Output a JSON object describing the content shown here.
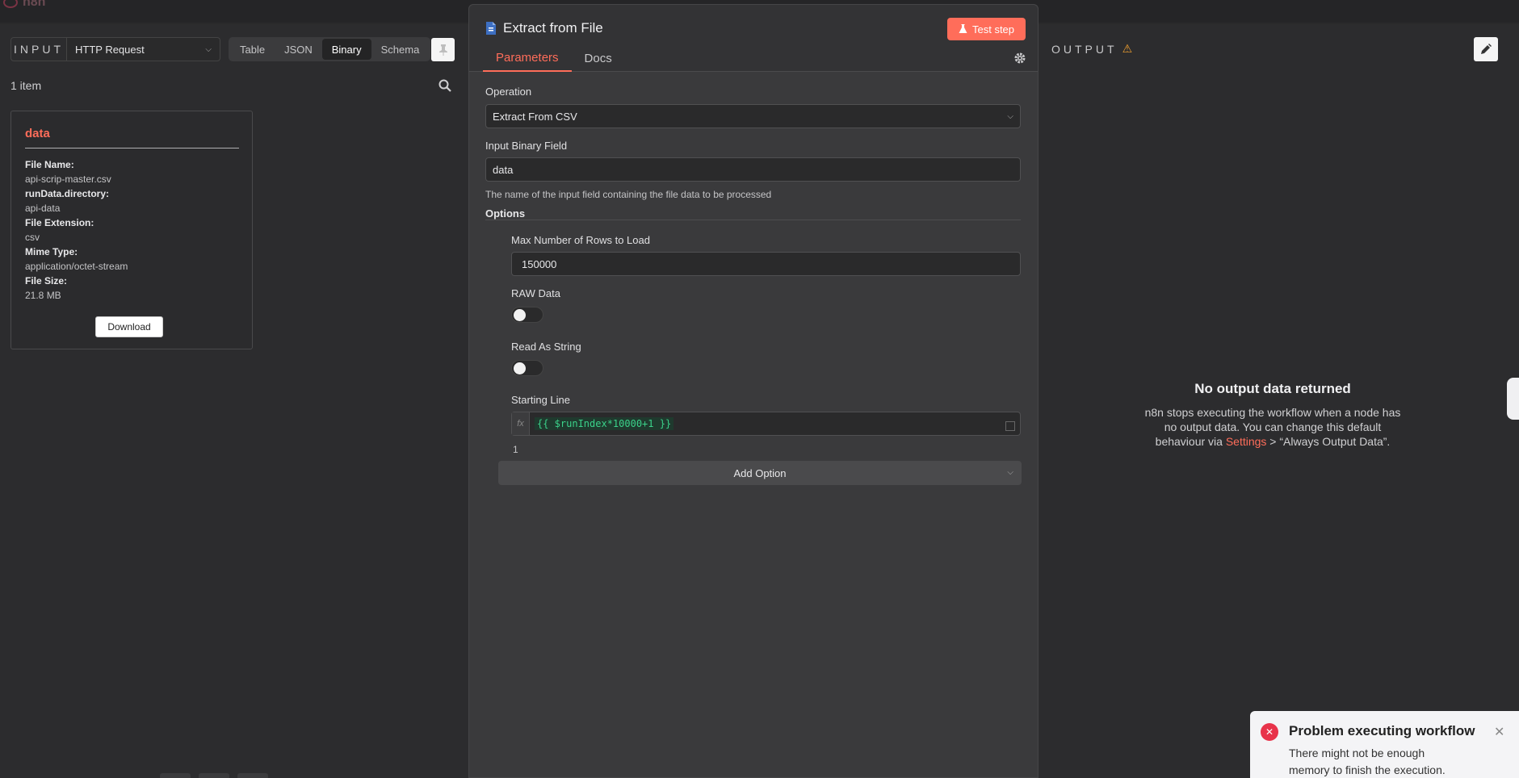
{
  "app": {
    "name": "n8n"
  },
  "input": {
    "label": "INPUT",
    "node": "HTTP Request",
    "view_tabs": [
      "Table",
      "JSON",
      "Binary",
      "Schema"
    ],
    "active_view": "Binary",
    "item_count": "1 item",
    "card": {
      "title": "data",
      "fields": [
        {
          "key": "File Name:",
          "value": "api-scrip-master.csv"
        },
        {
          "key": "runData.directory:",
          "value": "api-data"
        },
        {
          "key": "File Extension:",
          "value": "csv"
        },
        {
          "key": "Mime Type:",
          "value": "application/octet-stream"
        },
        {
          "key": "File Size:",
          "value": "21.8 MB"
        }
      ],
      "download_label": "Download"
    }
  },
  "node": {
    "title": "Extract from File",
    "test_button": "Test step",
    "tabs": [
      "Parameters",
      "Docs"
    ],
    "active_tab": "Parameters",
    "operation": {
      "label": "Operation",
      "value": "Extract From CSV"
    },
    "binary_field": {
      "label": "Input Binary Field",
      "value": "data",
      "hint": "The name of the input field containing the file data to be processed"
    },
    "options_title": "Options",
    "max_rows": {
      "label": "Max Number of Rows to Load",
      "value": "150000"
    },
    "raw_data": {
      "label": "RAW Data",
      "enabled": false
    },
    "read_as_string": {
      "label": "Read As String",
      "enabled": false
    },
    "starting_line": {
      "label": "Starting Line",
      "fx": "fx",
      "expression": "{{ $runIndex*10000+1 }}",
      "result": "1"
    },
    "add_option": "Add Option"
  },
  "output": {
    "label": "OUTPUT",
    "empty_title": "No output data returned",
    "empty_text_before": "n8n stops executing the workflow when a node has no output data. You can change this default behaviour via ",
    "empty_link": "Settings",
    "empty_text_after": " > “Always Output Data”."
  },
  "toast": {
    "title": "Problem executing workflow",
    "text": "There might not be enough memory to finish the execution. Tips for"
  },
  "colors": {
    "accent": "#ff6d5a",
    "error": "#e8334a",
    "warning": "#f0a030"
  }
}
